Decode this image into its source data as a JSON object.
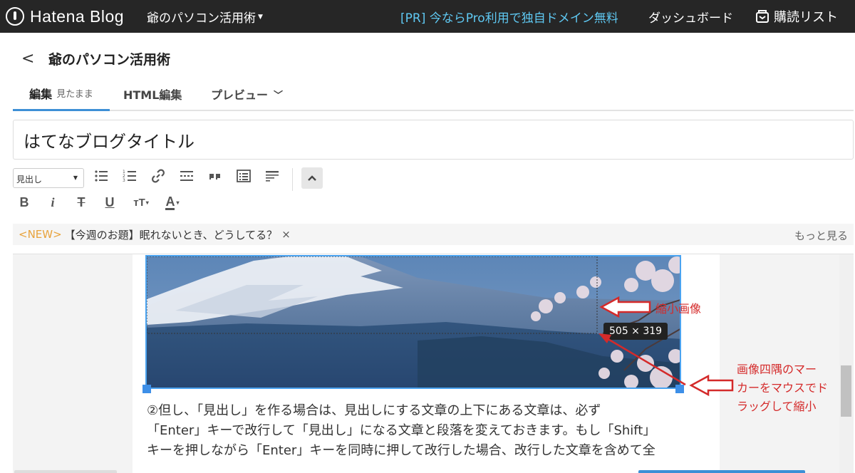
{
  "topbar": {
    "logo_text": "Hatena Blog",
    "blog_switch": "爺のパソコン活用術",
    "pr_link": "[PR] 今ならPro利用で独自ドメイン無料",
    "dashboard": "ダッシュボード",
    "reading_list": "購読リスト"
  },
  "header": {
    "back": "<",
    "title": "爺のパソコン活用術"
  },
  "tabs": {
    "edit": "編集",
    "edit_sub": "見たまま",
    "html": "HTML編集",
    "preview": "プレビュー"
  },
  "title_input": {
    "value": "はてなブログタイトル"
  },
  "toolbar": {
    "heading_select": "見出し",
    "bold": "B",
    "italic": "i",
    "strike": "T",
    "underline": "U",
    "font_size": "тT",
    "color": "A"
  },
  "notice": {
    "new_label": "<NEW>",
    "text": "【今週のお題】眠れないとき、どうしてる？",
    "close": "×",
    "more": "もっと見る"
  },
  "editor": {
    "image_size": "505 × 319",
    "lines": [
      "②但し、「見出し」を作る場合は、見出しにする文章の上下にある文章は、必ず",
      "「Enter」キーで改行して「見出し」になる文章と段落を変えておきます。もし「Shift」",
      "キーを押しながら「Enter」キーを同時に押して改行した場合、改行した文章を含めて全"
    ]
  },
  "annotations": {
    "small_image": "縮小画像",
    "corner_markers": [
      "画像四隅のマー",
      "カーをマウスでド",
      "ラッグして縮小"
    ]
  },
  "colors": {
    "topbar_bg": "#262626",
    "pr_link": "#5fc9f3",
    "accent": "#3d8fd6",
    "annotation": "#d42a2a",
    "new_label": "#e8a33c"
  }
}
